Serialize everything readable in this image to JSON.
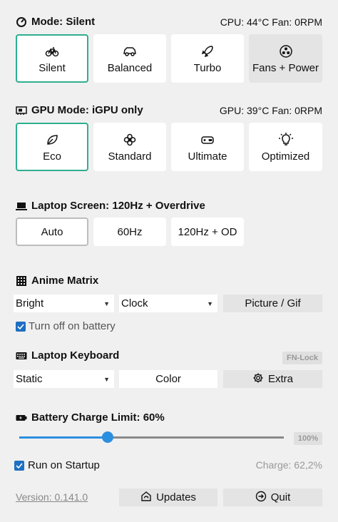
{
  "mode": {
    "title": "Mode: Silent",
    "status": "CPU: 44°C Fan: 0RPM",
    "tiles": [
      {
        "label": "Silent",
        "icon": "bike-icon"
      },
      {
        "label": "Balanced",
        "icon": "car-icon"
      },
      {
        "label": "Turbo",
        "icon": "rocket-icon"
      },
      {
        "label": "Fans + Power",
        "icon": "fan-icon"
      }
    ]
  },
  "gpu": {
    "title": "GPU Mode: iGPU only",
    "status": "GPU: 39°C Fan: 0RPM",
    "tiles": [
      {
        "label": "Eco",
        "icon": "leaf-icon"
      },
      {
        "label": "Standard",
        "icon": "flower-icon"
      },
      {
        "label": "Ultimate",
        "icon": "gamepad-icon"
      },
      {
        "label": "Optimized",
        "icon": "bulb-icon"
      }
    ]
  },
  "screen": {
    "title": "Laptop Screen: 120Hz + Overdrive",
    "buttons": [
      "Auto",
      "60Hz",
      "120Hz + OD"
    ]
  },
  "matrix": {
    "title": "Anime Matrix",
    "brightness": "Bright",
    "mode": "Clock",
    "picture_button": "Picture / Gif",
    "battery_off_label": "Turn off on battery"
  },
  "keyboard": {
    "title": "Laptop Keyboard",
    "fn_lock": "FN-Lock",
    "mode": "Static",
    "color_button": "Color",
    "extra_button": "Extra"
  },
  "battery": {
    "title": "Battery Charge Limit: 60%",
    "limit_fraction": 0.6,
    "max_label": "100%"
  },
  "footer": {
    "startup_label": "Run on Startup",
    "charge": "Charge: 62,2%",
    "version": "Version: 0.141.0",
    "updates_button": "Updates",
    "quit_button": "Quit"
  },
  "colors": {
    "accent": "#2eaf8f",
    "slider": "#2b8fe0",
    "checkbox": "#1e6fc2"
  }
}
